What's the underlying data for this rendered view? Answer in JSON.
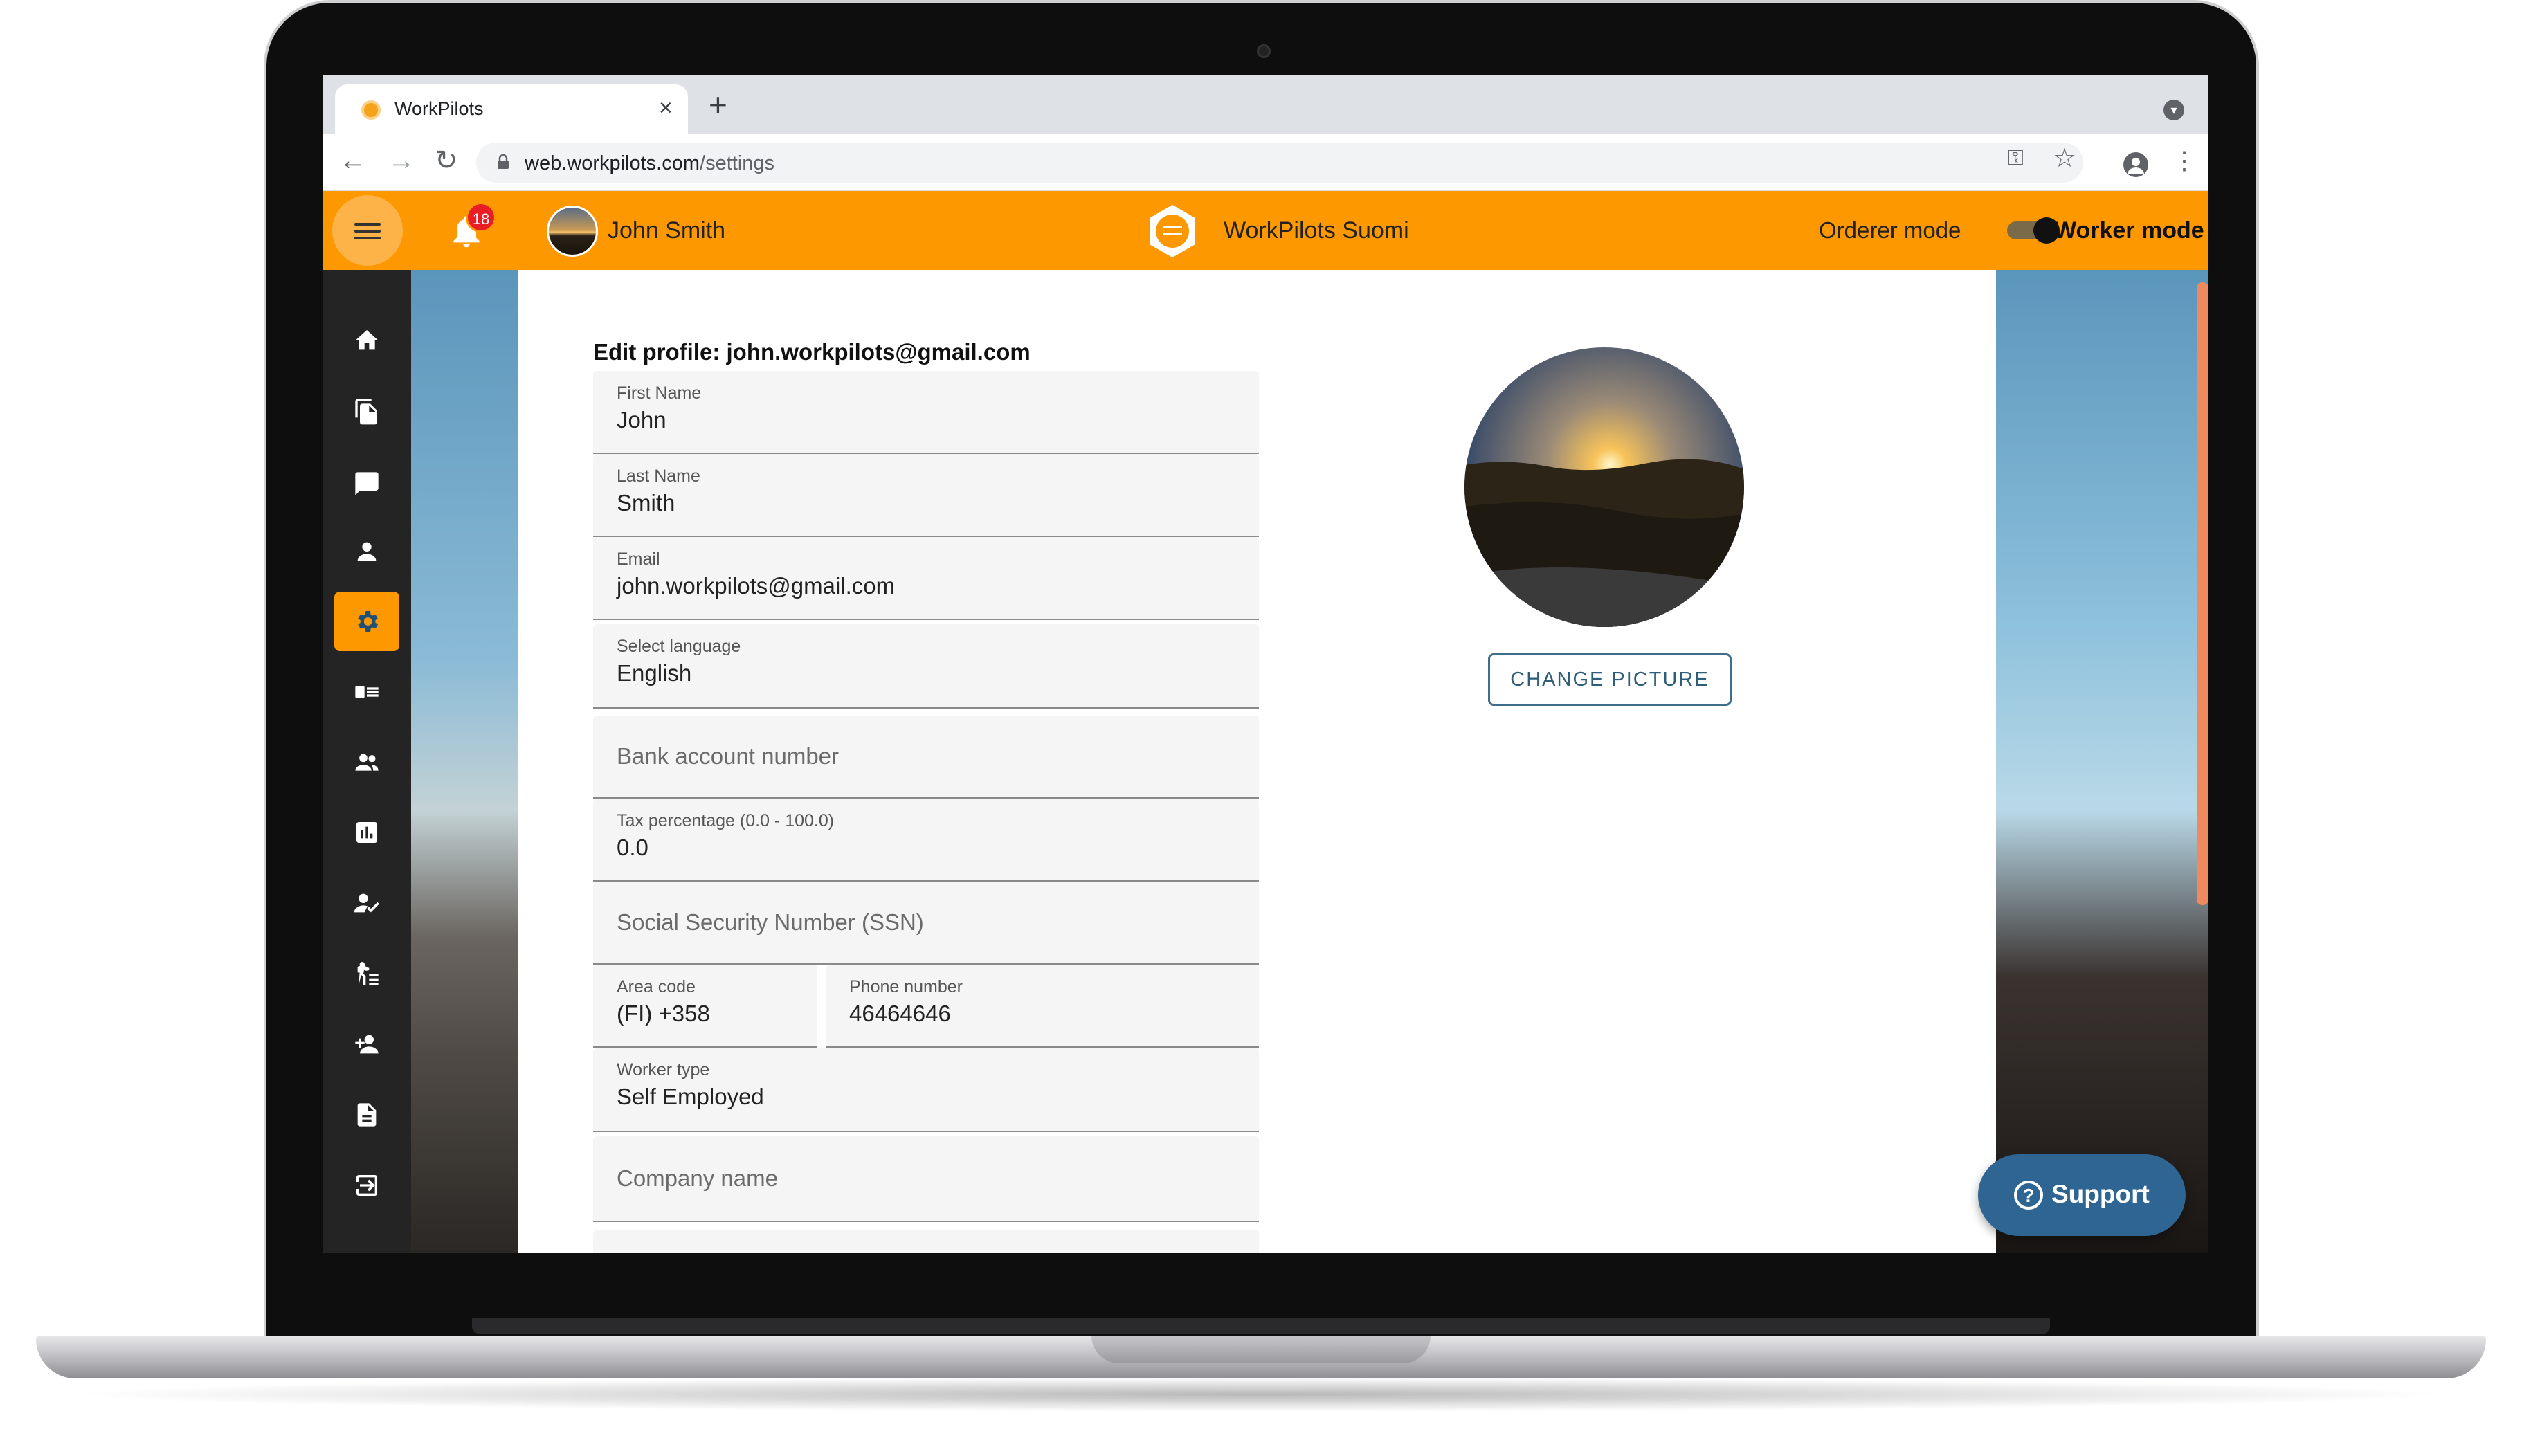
{
  "browser": {
    "tab_title": "WorkPilots",
    "tab_close": "×",
    "new_tab": "+",
    "url_domain": "web.workpilots.com",
    "url_path": "/settings"
  },
  "header": {
    "notifications_count": "18",
    "user_name": "John Smith",
    "brand_name": "WorkPilots Suomi",
    "orderer_mode_label": "Orderer mode",
    "worker_mode_label": "Worker mode",
    "mode_toggle_on": true
  },
  "sidebar": {
    "items": [
      {
        "icon": "home-icon"
      },
      {
        "icon": "documents-icon"
      },
      {
        "icon": "chat-icon"
      },
      {
        "icon": "person-icon"
      },
      {
        "icon": "settings-icon",
        "active": true
      },
      {
        "icon": "id-card-icon"
      },
      {
        "icon": "group-icon"
      },
      {
        "icon": "chart-icon"
      },
      {
        "icon": "person-check-icon"
      },
      {
        "icon": "worker-list-icon"
      },
      {
        "icon": "add-person-icon"
      },
      {
        "icon": "file-icon"
      },
      {
        "icon": "logout-icon"
      }
    ]
  },
  "form": {
    "title": "Edit profile: john.workpilots@gmail.com",
    "first_name": {
      "label": "First Name",
      "value": "John"
    },
    "last_name": {
      "label": "Last Name",
      "value": "Smith"
    },
    "email": {
      "label": "Email",
      "value": "john.workpilots@gmail.com"
    },
    "language": {
      "label": "Select language",
      "value": "English"
    },
    "bank_account": {
      "placeholder": "Bank account number"
    },
    "tax": {
      "label": "Tax percentage (0.0 - 100.0)",
      "value": "0.0"
    },
    "ssn": {
      "placeholder": "Social Security Number (SSN)"
    },
    "area_code": {
      "label": "Area code",
      "value": "(FI) +358"
    },
    "phone": {
      "label": "Phone number",
      "value": "46464646"
    },
    "worker_type": {
      "label": "Worker type",
      "value": "Self Employed"
    },
    "company_name": {
      "placeholder": "Company name"
    }
  },
  "profile": {
    "change_picture_label": "CHANGE PICTURE"
  },
  "support": {
    "label": "Support",
    "icon_glyph": "?"
  },
  "colors": {
    "brand_orange": "#fd9801",
    "sidebar_bg": "#242424",
    "support_blue": "#2f6593",
    "badge_red": "#ea1c24"
  }
}
